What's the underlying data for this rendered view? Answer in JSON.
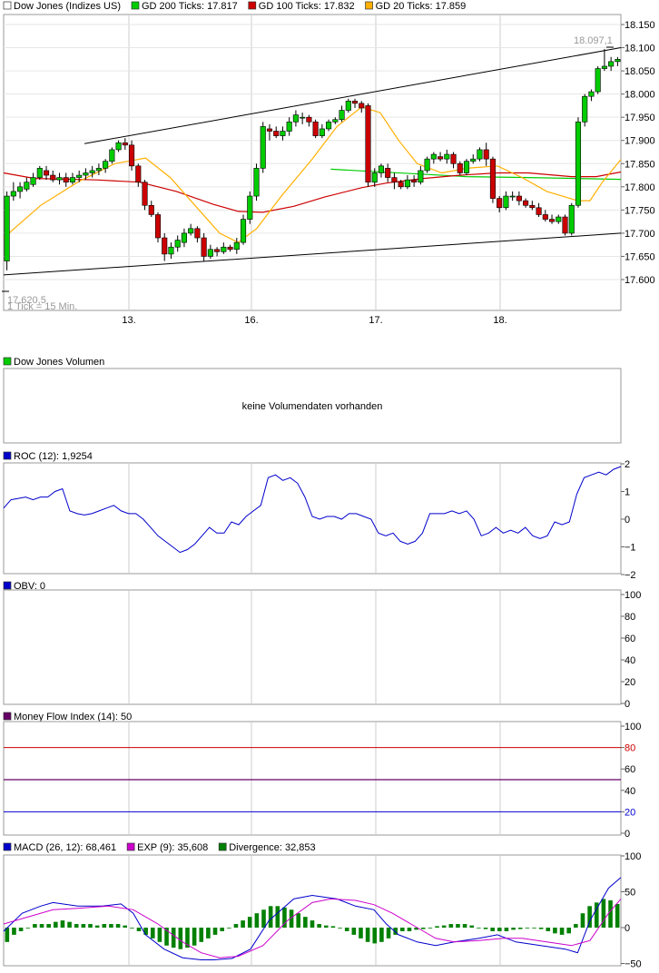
{
  "colors": {
    "up": "#00cc00",
    "down": "#cc0000",
    "gd200": "#00cc00",
    "gd100": "#cc0000",
    "gd20": "#ffb000",
    "roc": "#0000cc",
    "obv": "#0000cc",
    "mfi_square": "#660066",
    "macd": "#0000cc",
    "exp": "#cc00cc",
    "divergence": "#008000",
    "grid": "#cccccc",
    "border": "#999999"
  },
  "chart_data": [
    {
      "type": "candlestick",
      "legend": [
        {
          "label": "Dow Jones (Indizes US)",
          "color": "#ffffff"
        },
        {
          "label": "GD 200 Ticks: 17.817",
          "color": "#00cc00"
        },
        {
          "label": "GD 100 Ticks: 17.832",
          "color": "#cc0000"
        },
        {
          "label": "GD 20 Ticks: 17.859",
          "color": "#ffb000"
        }
      ],
      "yticks": [
        "18.150",
        "18.100",
        "18.050",
        "18.000",
        "17.950",
        "17.900",
        "17.850",
        "17.800",
        "17.750",
        "17.700",
        "17.650",
        "17.600"
      ],
      "ylim": [
        17585,
        18175
      ],
      "xticks": [
        "13.",
        "16.",
        "17.",
        "18."
      ],
      "footnote": "1 Tick = 15 Min.",
      "annotations": [
        "18.097,1",
        "17.620,5"
      ],
      "trendlines": [
        {
          "from": [
            0.131,
            17893
          ],
          "to": [
            1.0,
            18100
          ]
        },
        {
          "from": [
            0.0,
            17610
          ],
          "to": [
            1.0,
            17700
          ]
        }
      ],
      "candles": [
        [
          17640,
          17780,
          17620,
          17790
        ],
        [
          17780,
          17790,
          17770,
          17810
        ],
        [
          17790,
          17800,
          17775,
          17810
        ],
        [
          17795,
          17810,
          17790,
          17820
        ],
        [
          17805,
          17820,
          17800,
          17830
        ],
        [
          17820,
          17840,
          17815,
          17845
        ],
        [
          17835,
          17825,
          17815,
          17845
        ],
        [
          17825,
          17815,
          17810,
          17835
        ],
        [
          17815,
          17820,
          17805,
          17830
        ],
        [
          17820,
          17810,
          17800,
          17830
        ],
        [
          17810,
          17820,
          17805,
          17830
        ],
        [
          17820,
          17825,
          17810,
          17835
        ],
        [
          17825,
          17830,
          17815,
          17840
        ],
        [
          17830,
          17835,
          17820,
          17845
        ],
        [
          17835,
          17840,
          17825,
          17850
        ],
        [
          17840,
          17855,
          17830,
          17860
        ],
        [
          17855,
          17880,
          17850,
          17885
        ],
        [
          17880,
          17895,
          17875,
          17900
        ],
        [
          17895,
          17890,
          17880,
          17905
        ],
        [
          17890,
          17845,
          17835,
          17900
        ],
        [
          17845,
          17810,
          17800,
          17850
        ],
        [
          17810,
          17760,
          17750,
          17815
        ],
        [
          17760,
          17740,
          17735,
          17770
        ],
        [
          17740,
          17690,
          17680,
          17745
        ],
        [
          17690,
          17655,
          17640,
          17700
        ],
        [
          17655,
          17670,
          17645,
          17680
        ],
        [
          17670,
          17685,
          17660,
          17695
        ],
        [
          17680,
          17700,
          17670,
          17710
        ],
        [
          17700,
          17710,
          17695,
          17720
        ],
        [
          17710,
          17690,
          17680,
          17715
        ],
        [
          17690,
          17650,
          17640,
          17700
        ],
        [
          17650,
          17665,
          17645,
          17675
        ],
        [
          17665,
          17660,
          17650,
          17670
        ],
        [
          17660,
          17670,
          17655,
          17680
        ],
        [
          17670,
          17665,
          17660,
          17675
        ],
        [
          17665,
          17680,
          17655,
          17690
        ],
        [
          17680,
          17730,
          17675,
          17740
        ],
        [
          17730,
          17780,
          17720,
          17790
        ],
        [
          17780,
          17840,
          17770,
          17850
        ],
        [
          17840,
          17930,
          17830,
          17940
        ],
        [
          17925,
          17920,
          17900,
          17935
        ],
        [
          17920,
          17910,
          17905,
          17930
        ],
        [
          17910,
          17920,
          17900,
          17930
        ],
        [
          17920,
          17940,
          17910,
          17950
        ],
        [
          17940,
          17955,
          17930,
          17965
        ],
        [
          17950,
          17950,
          17935,
          17960
        ],
        [
          17950,
          17940,
          17930,
          17955
        ],
        [
          17940,
          17910,
          17905,
          17945
        ],
        [
          17910,
          17925,
          17905,
          17935
        ],
        [
          17925,
          17940,
          17920,
          17945
        ],
        [
          17940,
          17945,
          17935,
          17950
        ],
        [
          17945,
          17965,
          17940,
          17975
        ],
        [
          17965,
          17985,
          17960,
          17990
        ],
        [
          17985,
          17980,
          17970,
          17990
        ],
        [
          17980,
          17970,
          17960,
          17985
        ],
        [
          17975,
          17810,
          17800,
          17980
        ],
        [
          17810,
          17830,
          17800,
          17840
        ],
        [
          17830,
          17845,
          17820,
          17850
        ],
        [
          17840,
          17820,
          17810,
          17850
        ],
        [
          17820,
          17810,
          17795,
          17830
        ],
        [
          17810,
          17800,
          17795,
          17815
        ],
        [
          17800,
          17815,
          17795,
          17825
        ],
        [
          17815,
          17810,
          17800,
          17825
        ],
        [
          17810,
          17835,
          17805,
          17845
        ],
        [
          17835,
          17860,
          17830,
          17865
        ],
        [
          17860,
          17870,
          17850,
          17875
        ],
        [
          17865,
          17860,
          17855,
          17875
        ],
        [
          17860,
          17870,
          17850,
          17880
        ],
        [
          17870,
          17850,
          17840,
          17875
        ],
        [
          17850,
          17830,
          17825,
          17855
        ],
        [
          17830,
          17855,
          17825,
          17860
        ],
        [
          17855,
          17860,
          17850,
          17870
        ],
        [
          17860,
          17880,
          17855,
          17885
        ],
        [
          17880,
          17860,
          17845,
          17895
        ],
        [
          17860,
          17775,
          17765,
          17865
        ],
        [
          17775,
          17755,
          17745,
          17780
        ],
        [
          17755,
          17780,
          17750,
          17790
        ],
        [
          17780,
          17780,
          17770,
          17790
        ],
        [
          17780,
          17770,
          17760,
          17790
        ],
        [
          17770,
          17760,
          17755,
          17775
        ],
        [
          17760,
          17755,
          17750,
          17770
        ],
        [
          17755,
          17740,
          17735,
          17765
        ],
        [
          17740,
          17730,
          17725,
          17750
        ],
        [
          17730,
          17725,
          17720,
          17740
        ],
        [
          17725,
          17735,
          17720,
          17740
        ],
        [
          17735,
          17700,
          17695,
          17740
        ],
        [
          17700,
          17760,
          17695,
          17765
        ],
        [
          17760,
          17940,
          17755,
          17950
        ],
        [
          17940,
          17995,
          17930,
          18000
        ],
        [
          17995,
          18005,
          17985,
          18010
        ],
        [
          18005,
          18055,
          18000,
          18060
        ],
        [
          18055,
          18060,
          18050,
          18097
        ],
        [
          18060,
          18070,
          18050,
          18080
        ],
        [
          18070,
          18075,
          18060,
          18080
        ]
      ],
      "gd200": [
        [
          0.53,
          17838
        ],
        [
          0.75,
          17822
        ],
        [
          0.85,
          17820
        ],
        [
          1.0,
          17816
        ]
      ],
      "gd100": [
        [
          0.0,
          17830
        ],
        [
          0.05,
          17818
        ],
        [
          0.15,
          17815
        ],
        [
          0.22,
          17810
        ],
        [
          0.28,
          17790
        ],
        [
          0.34,
          17762
        ],
        [
          0.38,
          17747
        ],
        [
          0.42,
          17745
        ],
        [
          0.47,
          17758
        ],
        [
          0.52,
          17778
        ],
        [
          0.58,
          17798
        ],
        [
          0.62,
          17808
        ],
        [
          0.68,
          17818
        ],
        [
          0.74,
          17825
        ],
        [
          0.8,
          17830
        ],
        [
          0.85,
          17830
        ],
        [
          0.92,
          17822
        ],
        [
          0.96,
          17822
        ],
        [
          1.0,
          17832
        ]
      ],
      "gd20": [
        [
          0.0,
          17690
        ],
        [
          0.06,
          17760
        ],
        [
          0.12,
          17810
        ],
        [
          0.18,
          17850
        ],
        [
          0.23,
          17862
        ],
        [
          0.27,
          17820
        ],
        [
          0.31,
          17760
        ],
        [
          0.35,
          17700
        ],
        [
          0.38,
          17680
        ],
        [
          0.41,
          17710
        ],
        [
          0.45,
          17780
        ],
        [
          0.5,
          17860
        ],
        [
          0.54,
          17930
        ],
        [
          0.58,
          17972
        ],
        [
          0.61,
          17960
        ],
        [
          0.64,
          17900
        ],
        [
          0.67,
          17850
        ],
        [
          0.71,
          17830
        ],
        [
          0.75,
          17840
        ],
        [
          0.8,
          17845
        ],
        [
          0.84,
          17820
        ],
        [
          0.88,
          17790
        ],
        [
          0.93,
          17770
        ],
        [
          0.95,
          17770
        ],
        [
          0.97,
          17810
        ],
        [
          1.0,
          17859
        ]
      ]
    },
    {
      "type": "bar",
      "legend": [
        {
          "label": "Dow Jones Volumen",
          "color": "#00cc00"
        }
      ],
      "message": "keine Volumendaten vorhanden"
    },
    {
      "type": "line",
      "legend": [
        {
          "label": "ROC (12): 1,9254",
          "color": "#0000cc"
        }
      ],
      "yticks": [
        "2",
        "1",
        "0",
        "−1",
        "−2"
      ],
      "ylim": [
        -2,
        2
      ],
      "values": [
        0.4,
        0.7,
        0.75,
        0.8,
        0.7,
        0.8,
        0.8,
        1.0,
        1.1,
        0.3,
        0.2,
        0.15,
        0.2,
        0.3,
        0.4,
        0.5,
        0.3,
        0.2,
        0.2,
        0.0,
        -0.3,
        -0.6,
        -0.8,
        -1.0,
        -1.2,
        -1.1,
        -0.9,
        -0.6,
        -0.3,
        -0.5,
        -0.5,
        -0.1,
        -0.2,
        0.1,
        0.3,
        0.5,
        1.5,
        1.6,
        1.4,
        1.5,
        1.3,
        0.8,
        0.1,
        0.0,
        0.1,
        0.1,
        0.0,
        0.2,
        0.2,
        0.1,
        0.0,
        -0.5,
        -0.6,
        -0.5,
        -0.8,
        -0.9,
        -0.8,
        -0.5,
        0.2,
        0.2,
        0.2,
        0.3,
        0.2,
        0.3,
        0.0,
        -0.6,
        -0.5,
        -0.3,
        -0.5,
        -0.4,
        -0.5,
        -0.3,
        -0.6,
        -0.7,
        -0.6,
        -0.1,
        -0.2,
        -0.1,
        0.9,
        1.5,
        1.6,
        1.7,
        1.6,
        1.8,
        1.9
      ]
    },
    {
      "type": "line",
      "legend": [
        {
          "label": "OBV: 0",
          "color": "#0000cc"
        }
      ],
      "yticks": [
        "100",
        "80",
        "60",
        "40",
        "20",
        "0"
      ],
      "ylim": [
        0,
        100
      ],
      "values": []
    },
    {
      "type": "line",
      "legend": [
        {
          "label": "Money Flow Index (14): 50",
          "color": "#660066"
        }
      ],
      "yticks": [
        "100",
        "80",
        "60",
        "40",
        "20",
        "0"
      ],
      "red_tick": "80",
      "blue_tick": "20",
      "ylim": [
        0,
        100
      ],
      "levels": [
        80,
        50,
        20
      ],
      "values": [
        50
      ]
    },
    {
      "type": "bar",
      "legend": [
        {
          "label": "MACD (26, 12): 68,461",
          "color": "#0000cc"
        },
        {
          "label": "EXP (9): 35,608",
          "color": "#cc00cc"
        },
        {
          "label": "Divergence: 32,853",
          "color": "#008000"
        }
      ],
      "yticks": [
        "100",
        "50",
        "0",
        "−50"
      ],
      "ylim": [
        -50,
        100
      ],
      "macd": [
        [
          0.0,
          -5
        ],
        [
          0.03,
          20
        ],
        [
          0.06,
          30
        ],
        [
          0.08,
          35
        ],
        [
          0.12,
          30
        ],
        [
          0.16,
          30
        ],
        [
          0.19,
          33
        ],
        [
          0.21,
          20
        ],
        [
          0.23,
          -10
        ],
        [
          0.26,
          -30
        ],
        [
          0.29,
          -42
        ],
        [
          0.32,
          -45
        ],
        [
          0.34,
          -45
        ],
        [
          0.37,
          -43
        ],
        [
          0.4,
          -30
        ],
        [
          0.43,
          10
        ],
        [
          0.47,
          40
        ],
        [
          0.5,
          45
        ],
        [
          0.54,
          40
        ],
        [
          0.57,
          30
        ],
        [
          0.6,
          25
        ],
        [
          0.62,
          5
        ],
        [
          0.64,
          -10
        ],
        [
          0.67,
          -20
        ],
        [
          0.7,
          -25
        ],
        [
          0.73,
          -20
        ],
        [
          0.77,
          -15
        ],
        [
          0.8,
          -10
        ],
        [
          0.83,
          -20
        ],
        [
          0.87,
          -25
        ],
        [
          0.91,
          -30
        ],
        [
          0.93,
          -35
        ],
        [
          0.95,
          10
        ],
        [
          0.98,
          55
        ],
        [
          1.0,
          70
        ]
      ],
      "exp": [
        [
          0.0,
          5
        ],
        [
          0.04,
          15
        ],
        [
          0.08,
          25
        ],
        [
          0.12,
          27
        ],
        [
          0.17,
          30
        ],
        [
          0.21,
          25
        ],
        [
          0.25,
          5
        ],
        [
          0.29,
          -20
        ],
        [
          0.32,
          -35
        ],
        [
          0.35,
          -42
        ],
        [
          0.38,
          -40
        ],
        [
          0.42,
          -25
        ],
        [
          0.46,
          10
        ],
        [
          0.5,
          35
        ],
        [
          0.53,
          40
        ],
        [
          0.57,
          38
        ],
        [
          0.6,
          32
        ],
        [
          0.63,
          20
        ],
        [
          0.67,
          0
        ],
        [
          0.7,
          -15
        ],
        [
          0.73,
          -20
        ],
        [
          0.77,
          -18
        ],
        [
          0.81,
          -15
        ],
        [
          0.84,
          -15
        ],
        [
          0.88,
          -20
        ],
        [
          0.92,
          -25
        ],
        [
          0.95,
          -18
        ],
        [
          0.98,
          20
        ],
        [
          1.0,
          40
        ]
      ],
      "divergence": [
        -20,
        -10,
        -5,
        0,
        5,
        5,
        5,
        8,
        10,
        8,
        5,
        5,
        5,
        3,
        5,
        5,
        5,
        3,
        0,
        -5,
        -10,
        -15,
        -20,
        -25,
        -28,
        -30,
        -28,
        -25,
        -20,
        -15,
        -10,
        -5,
        0,
        5,
        10,
        15,
        20,
        25,
        30,
        30,
        28,
        25,
        20,
        15,
        10,
        5,
        3,
        2,
        0,
        -5,
        -10,
        -15,
        -20,
        -22,
        -20,
        -15,
        -10,
        -5,
        -5,
        -3,
        -2,
        0,
        2,
        3,
        5,
        5,
        5,
        3,
        0,
        -2,
        -5,
        -5,
        -5,
        -3,
        -2,
        0,
        0,
        -2,
        -5,
        -8,
        -10,
        -8,
        5,
        20,
        30,
        35,
        40,
        38,
        33
      ]
    }
  ]
}
